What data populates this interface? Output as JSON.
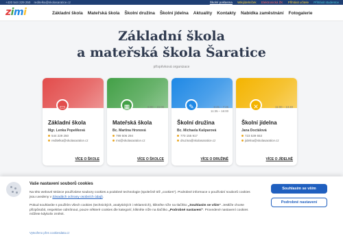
{
  "topbar": {
    "phone": "+420 544 229 250",
    "email": "reditelka@skolasaratice.cz",
    "links": [
      "Školní poklasma",
      "Wikijídelníček",
      "Elektronická ŽK",
      "Přihlásit učitele",
      "Přihlásit studentov"
    ]
  },
  "logo": {
    "text": [
      "z",
      "i",
      "m",
      "i"
    ]
  },
  "nav": [
    "Základní škola",
    "Mateřská škola",
    "Školní družina",
    "Školní jídelna",
    "Aktuality",
    "Kontakty",
    "Nabídka zaměstnání",
    "Fotogalerie"
  ],
  "hero": {
    "line1": "Základní škola",
    "line2": "a mateřská škola Šaratice",
    "subtitle": "příspěvková organizace"
  },
  "cards": [
    {
      "title": "Základní škola",
      "person": "Mgr. Lenka Popelíková",
      "phone": "544 229 250",
      "email": "reditelka@skolasaratice.cz",
      "hours": [
        "",
        ""
      ],
      "more": "VÍCE O ŠKOLE",
      "color": "#e24c4b",
      "badge_icon": "book-icon",
      "badge_glyph": "▭"
    },
    {
      "title": "Mateřská škola",
      "person": "Bc. Martina Hronová",
      "phone": "799 506 294",
      "email": "ms@skolasaratice.cz",
      "hours": [
        "6:00 – 15:00",
        ""
      ],
      "more": "VÍCE O ŠKOLCE",
      "color": "#43a047",
      "badge_icon": "blocks-icon",
      "badge_glyph": "▦"
    },
    {
      "title": "Školní družina",
      "person": "Bc. Michaela Kašparová",
      "phone": "770 155 917",
      "email": "druzina@skolasaratice.cz",
      "hours": [
        "6:45 – 7:45",
        "11:35 – 16:00"
      ],
      "more": "VÍCE O DRUŽINĚ",
      "color": "#1e88e5",
      "badge_icon": "pencil-icon",
      "badge_glyph": "✎"
    },
    {
      "title": "Školní jídelna",
      "person": "Jana Doctálová",
      "phone": "723 539 653",
      "email": "jidelna@skolasaratice.cz",
      "hours": [
        "11:00 – 13:40",
        ""
      ],
      "more": "VÍCE O JÍDELNĚ",
      "color": "#f4b400",
      "badge_icon": "utensils-icon",
      "badge_glyph": "✕"
    }
  ],
  "cookie": {
    "title": "Vaše nastavení souborů cookies",
    "p1_a": "Na této webové stránce používáme soubory cookies a podobné technologie (společně též „cookies\"). Podrobné informace o používání souborů cookies jsou uvedeny v ",
    "p1_link": "Zásadách ochrany osobních údajů",
    "p1_b": ".",
    "p2_a": "Pokud souhlasíte s použitím všech cookies (technických, analytických i reklamních), klikněte níže na tlačítko ",
    "p2_b1": "„Souhlasím se vším\"",
    "p2_c": ". Jestliže chcete přizpůsobit, respektive odmítnout, pouze některé cookies dle kategorií, klikněte níže na tlačítko ",
    "p2_b2": "„Podrobné nastavení\"",
    "p2_d": ". Provedené nastavení cookies můžete kdykoliv změnit.",
    "footer": "Vytvořeno přes cookiesdata.cz",
    "accept": "Souhlasím se vším",
    "settings": "Podrobné nastavení"
  }
}
